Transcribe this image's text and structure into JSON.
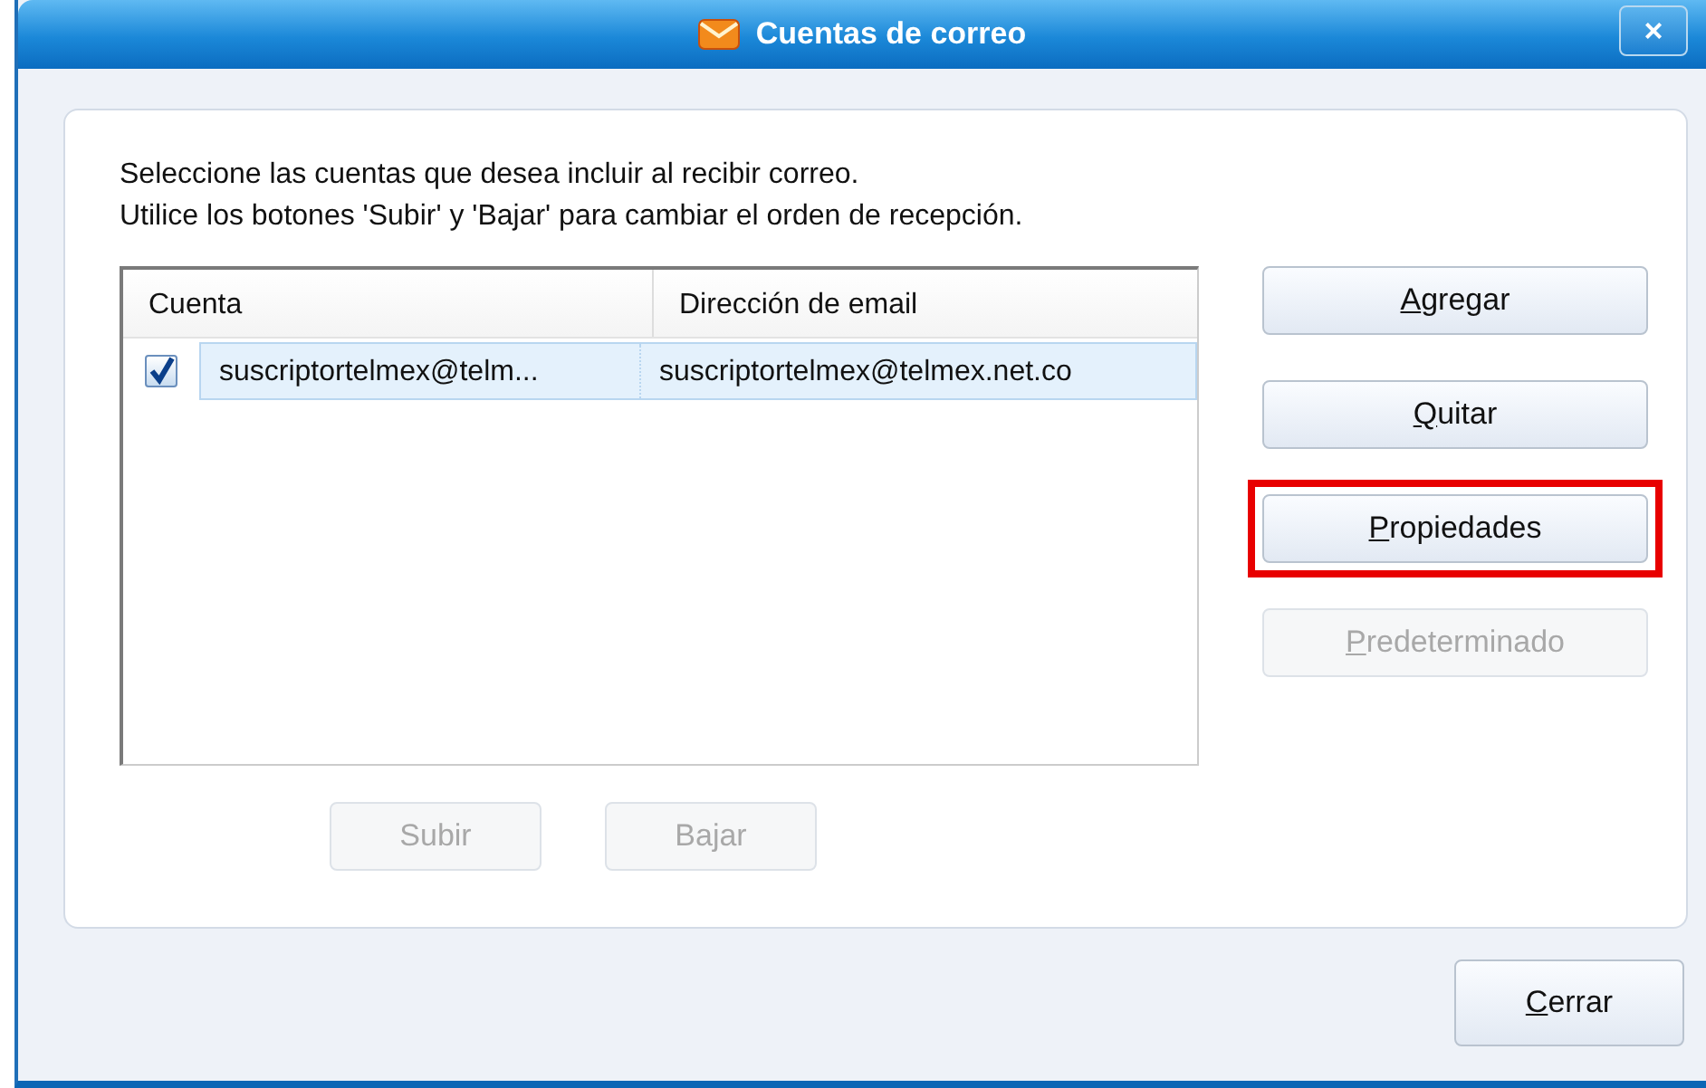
{
  "window": {
    "title": "Cuentas de correo",
    "close_label": "×"
  },
  "instructions": [
    "Seleccione las cuentas que desea incluir al recibir correo.",
    "Utilice los botones 'Subir' y 'Bajar' para cambiar el orden de recepción."
  ],
  "table": {
    "columns": [
      "Cuenta",
      "Dirección de email"
    ],
    "rows": [
      {
        "checked": true,
        "selected": true,
        "cells": [
          "suscriptortelmex@telm...",
          "suscriptortelmex@telmex.net.co"
        ]
      }
    ]
  },
  "side_buttons": [
    {
      "label": "Agregar",
      "disabled": false,
      "underline_first": true,
      "highlighted": false
    },
    {
      "label": "Quitar",
      "disabled": false,
      "underline_first": true,
      "highlighted": false
    },
    {
      "label": "Propiedades",
      "disabled": false,
      "underline_first": true,
      "highlighted": true
    },
    {
      "label": "Predeterminado",
      "disabled": true,
      "underline_first": true,
      "highlighted": false
    }
  ],
  "order_buttons": [
    {
      "label": "Subir",
      "disabled": true,
      "underline_first": false
    },
    {
      "label": "Bajar",
      "disabled": true,
      "underline_first": false
    }
  ],
  "footer_buttons": [
    {
      "label": "Cerrar",
      "disabled": false,
      "underline_first": true
    }
  ]
}
